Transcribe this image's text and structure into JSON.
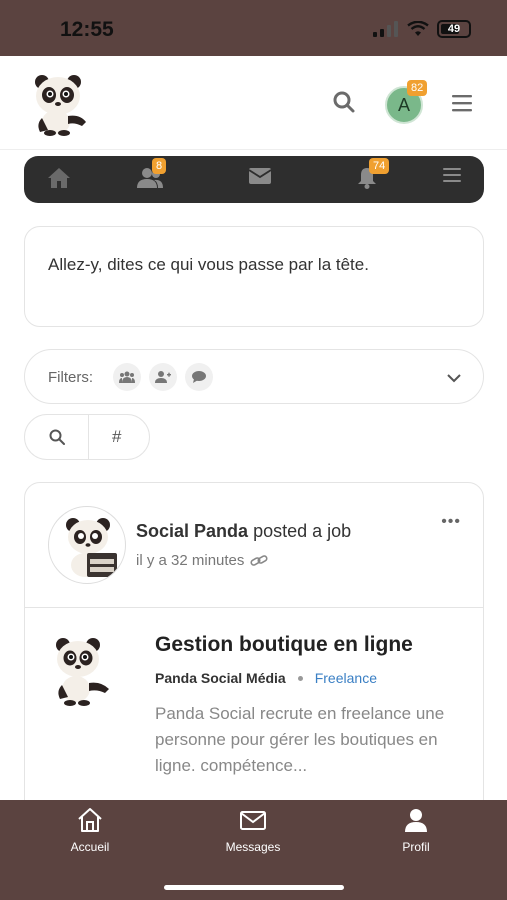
{
  "status_bar": {
    "time": "12:55",
    "battery": "49",
    "icons": [
      "signal-icon",
      "wifi-icon",
      "battery-icon"
    ]
  },
  "header": {
    "logo": "panda-logo",
    "avatar_letter": "A",
    "avatar_badge": "82"
  },
  "nav": {
    "friends_badge": "8",
    "notifications_badge": "74",
    "icons": [
      "home-icon",
      "friends-icon",
      "mail-icon",
      "bell-icon",
      "menu-icon"
    ]
  },
  "composer": {
    "placeholder": "Allez-y, dites ce qui vous passe par la tête."
  },
  "filters": {
    "label": "Filters:",
    "hash": "#"
  },
  "post": {
    "author": "Social Panda",
    "action": "posted a job",
    "time": "il y a 32 minutes",
    "more": "•••",
    "job": {
      "title": "Gestion boutique en ligne",
      "company": "Panda Social Média",
      "type": "Freelance",
      "description": "Panda Social recrute en freelance une personne pour gérer les boutiques en ligne.  compétence..."
    }
  },
  "tabbar": {
    "home": "Accueil",
    "messages": "Messages",
    "profile": "Profil"
  },
  "colors": {
    "brand_brown": "#5b4340",
    "nav_dark": "#2e2e2e",
    "badge": "#f0a030",
    "link": "#3a7fc4"
  }
}
